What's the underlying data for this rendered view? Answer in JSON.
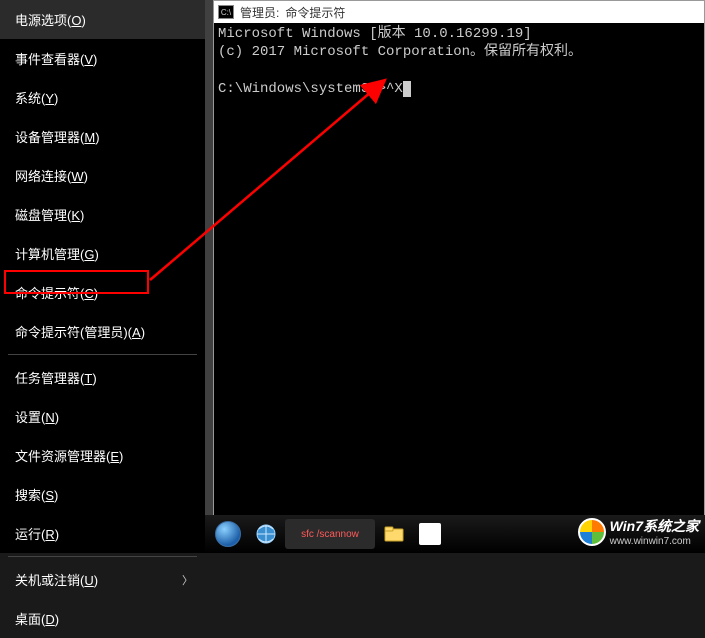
{
  "menu": {
    "items": [
      {
        "label": "电源选项",
        "key": "O"
      },
      {
        "label": "事件查看器",
        "key": "V"
      },
      {
        "label": "系统",
        "key": "Y"
      },
      {
        "label": "设备管理器",
        "key": "M"
      },
      {
        "label": "网络连接",
        "key": "W"
      },
      {
        "label": "磁盘管理",
        "key": "K"
      },
      {
        "label": "计算机管理",
        "key": "G"
      },
      {
        "label": "命令提示符",
        "key": "C"
      },
      {
        "label": "命令提示符(管理员)",
        "key": "A"
      },
      {
        "sep": true
      },
      {
        "label": "任务管理器",
        "key": "T"
      },
      {
        "label": "设置",
        "key": "N"
      },
      {
        "label": "文件资源管理器",
        "key": "E"
      },
      {
        "label": "搜索",
        "key": "S"
      },
      {
        "label": "运行",
        "key": "R"
      },
      {
        "sep": true
      },
      {
        "label": "关机或注销",
        "key": "U",
        "submenu": true
      },
      {
        "label": "桌面",
        "key": "D"
      }
    ]
  },
  "cmd": {
    "title_prefix": "管理员:",
    "title_app": "命令提示符",
    "line1": "Microsoft Windows [版本 10.0.16299.19]",
    "line2": "(c) 2017 Microsoft Corporation。保留所有权利。",
    "prompt": "C:\\Windows\\system32>",
    "input": "^X"
  },
  "taskbar": {
    "app1_hint": "sfc /scannow"
  },
  "watermark": {
    "line1": "Win7系统之家",
    "line2": "www.winwin7.com"
  }
}
